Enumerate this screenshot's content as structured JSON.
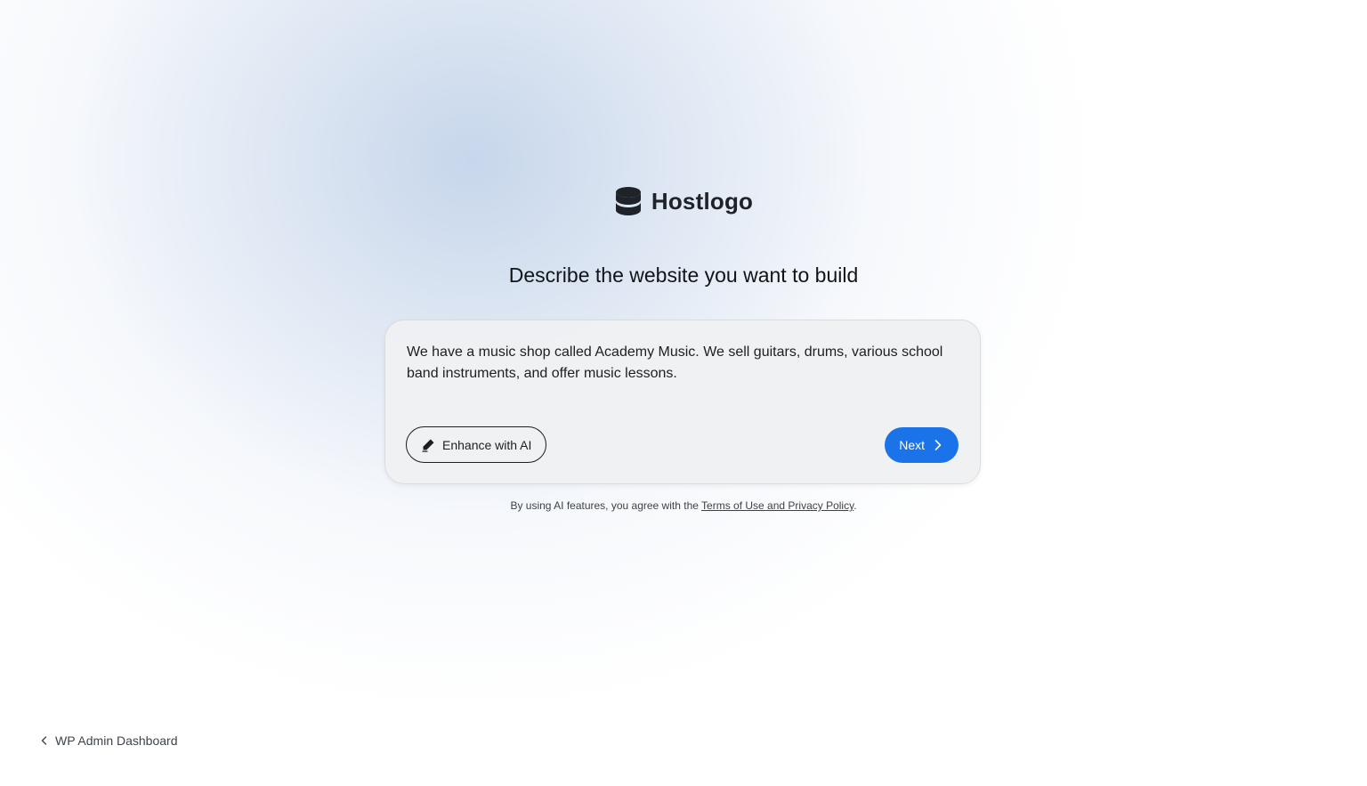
{
  "brand": {
    "name": "Hostlogo",
    "icon": "database-icon"
  },
  "headline": "Describe the website you want to build",
  "prompt": {
    "value": "We have a music shop called Academy Music. We sell guitars, drums, various school band instruments, and offer music lessons."
  },
  "buttons": {
    "enhance_label": "Enhance with AI",
    "enhance_icon": "pencil-icon",
    "next_label": "Next",
    "next_icon": "chevron-right-icon"
  },
  "disclaimer": {
    "prefix": "By using AI features, you agree with the ",
    "link_text": "Terms of Use and Privacy Policy",
    "suffix": "."
  },
  "back_link": {
    "label": "WP Admin Dashboard",
    "icon": "chevron-left-icon"
  },
  "colors": {
    "accent": "#1a73e8",
    "text": "#1e1e1e"
  }
}
